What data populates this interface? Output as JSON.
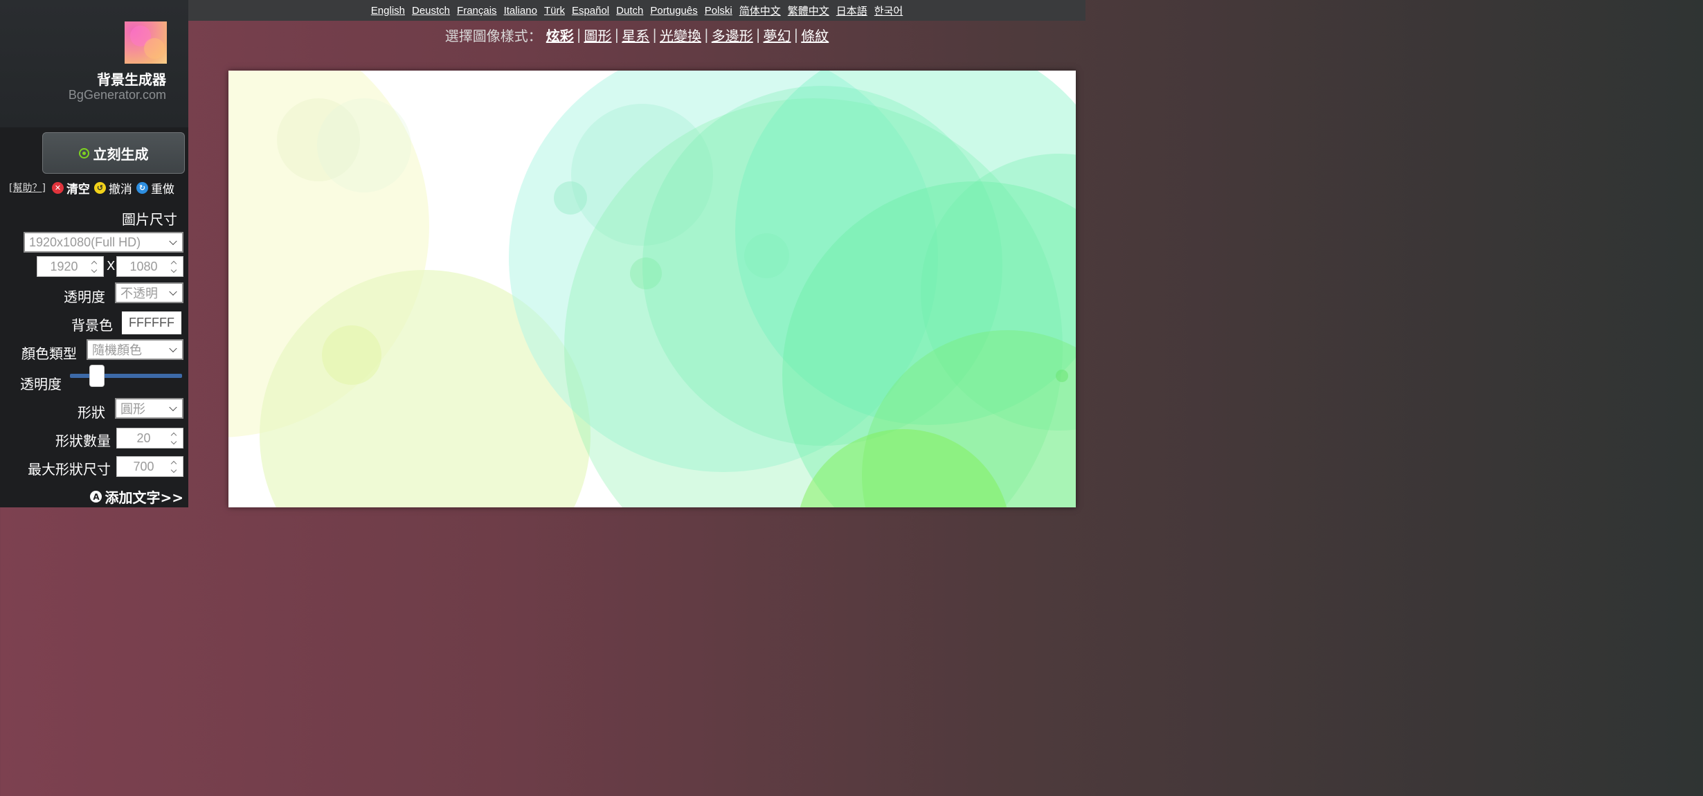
{
  "sidebar": {
    "brand_name": "背景生成器",
    "brand_domain": "BgGenerator.com",
    "generate_label": "立刻生成",
    "help_label": "[幫助？]",
    "clear_label": "清空",
    "undo_label": "撤消",
    "redo_label": "重做",
    "image_size_label": "圖片尺寸",
    "size_preset": "1920x1080(Full HD)",
    "width": "1920",
    "size_separator": "X",
    "height": "1080",
    "opacity_label": "透明度",
    "opacity_value": "不透明",
    "bg_color_label": "背景色",
    "bg_color_value": "FFFFFF",
    "color_type_label": "顏色類型",
    "color_type_value": "隨機顏色",
    "transparency_label": "透明度",
    "transparency_level": 0.2,
    "shape_label": "形狀",
    "shape_value": "圓形",
    "shape_count_label": "形狀數量",
    "shape_count": "20",
    "max_size_label": "最大形狀尺寸",
    "max_size": "700",
    "add_text_label": "添加文字>>"
  },
  "languages": [
    "English",
    "Deustch",
    "Français",
    "Italiano",
    "Türk",
    "Español",
    "Dutch",
    "Português",
    "Polski",
    "简体中文",
    "繁體中文",
    "日本語",
    "한국어"
  ],
  "style_bar": {
    "prefix": "選擇圖像樣式：",
    "styles": [
      "炫彩",
      "圖形",
      "星系",
      "光變換",
      "多邊形",
      "夢幻",
      "條紋"
    ],
    "active": "炫彩"
  },
  "colors": {
    "generate_icon": "#7ed321",
    "clear_icon": "#e0343c",
    "undo_icon": "#f2d21a",
    "redo_icon": "#2d8ee0",
    "slider": "#3d6aa8"
  },
  "icons": {
    "generate": "target-icon",
    "clear": "x-circle-icon",
    "undo": "undo-icon",
    "redo": "redo-icon",
    "add_text": "text-icon"
  }
}
